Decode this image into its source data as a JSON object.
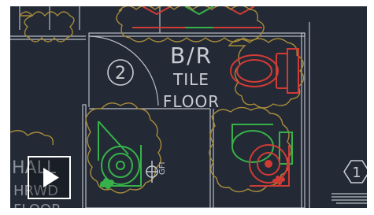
{
  "video": {
    "play_icon": "play-icon",
    "play_label": "Play video"
  },
  "drawing": {
    "room_name_line1": "B/R",
    "room_name_line2": "TILE",
    "room_name_line3": "FLOOR",
    "door_tag": "2",
    "window_tag": "1",
    "left_room_line1": "HALL",
    "left_room_line2": "HRWD",
    "left_room_line3": "FLOOR",
    "fixture_tag": "GFI",
    "colors": {
      "background": "#232a35",
      "walls": "#b9bdc4",
      "text": "#c9cdd3",
      "revision_cloud": "#a88a3a",
      "fixture_red": "#d13b35",
      "fixture_green": "#37b24a"
    }
  }
}
